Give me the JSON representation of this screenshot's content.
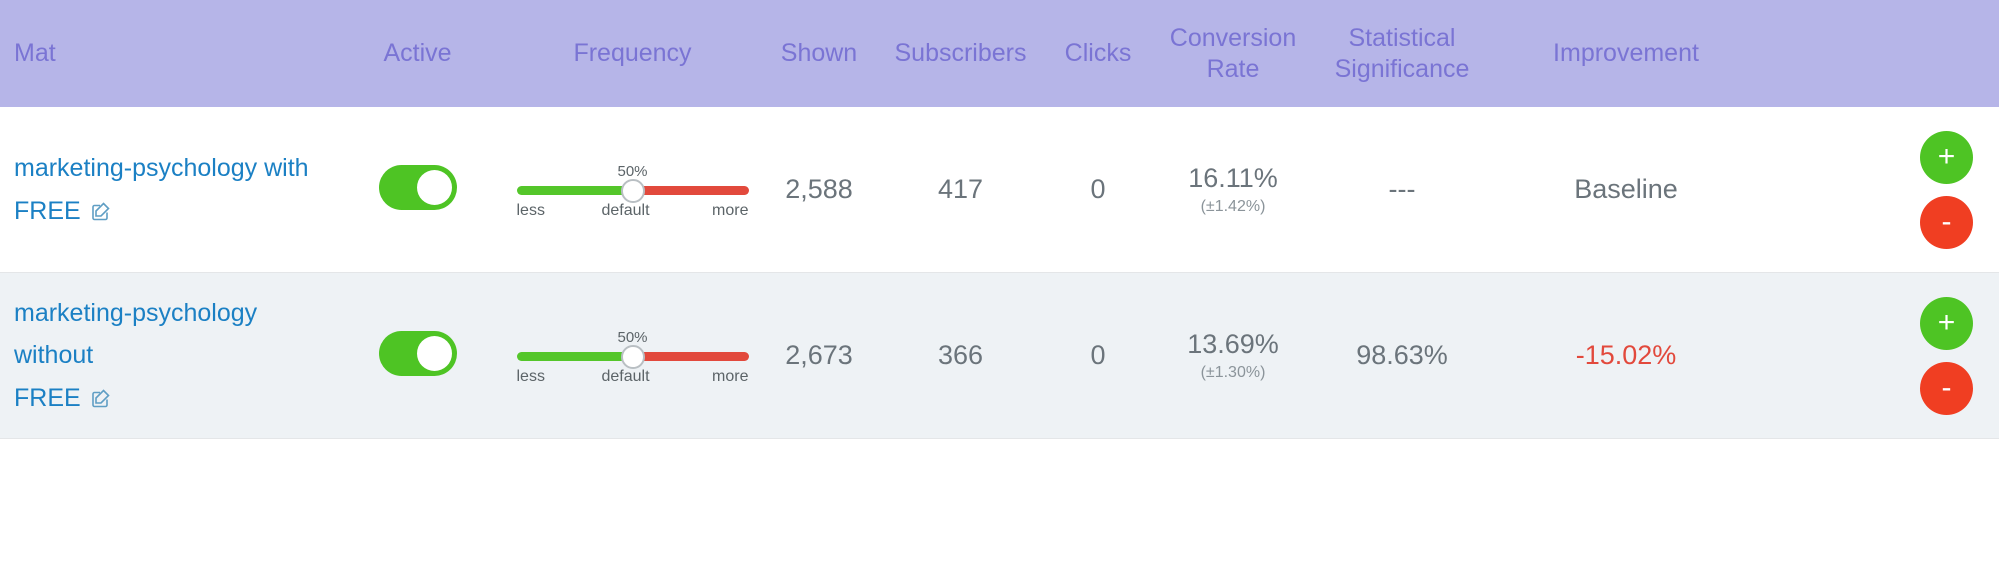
{
  "table": {
    "columns": {
      "mat": "Mat",
      "active": "Active",
      "frequency": "Frequency",
      "shown": "Shown",
      "subscribers": "Subscribers",
      "clicks": "Clicks",
      "conversion_rate_line1": "Conversion",
      "conversion_rate_line2": "Rate",
      "statistical_significance_line1": "Statistical",
      "statistical_significance_line2": "Significance",
      "improvement": "Improvement"
    },
    "header_bg": "#b6b5e8",
    "header_text_color": "#7a74d4",
    "link_color": "#1b80c4",
    "negative_color": "#e2493c",
    "toggle_on_color": "#4ec424",
    "slider_left_color": "#54c62a",
    "slider_right_color": "#e2493c",
    "rows": [
      {
        "name_line1": "marketing-psychology with",
        "name_line2": "FREE",
        "edit_icon": "edit-square-icon",
        "active": true,
        "frequency_value": "50%",
        "frequency_label_less": "less",
        "frequency_label_default": "default",
        "frequency_label_more": "more",
        "frequency_percent": 50,
        "shown": "2,588",
        "subscribers": "417",
        "clicks": "0",
        "conversion_rate": "16.11%",
        "conversion_rate_margin": "(±1.42%)",
        "statistical_significance": "---",
        "improvement": "Baseline",
        "improvement_negative": false,
        "add_label": "+",
        "remove_label": "-"
      },
      {
        "name_line1": "marketing-psychology without",
        "name_line2": "FREE",
        "edit_icon": "edit-square-icon",
        "active": true,
        "frequency_value": "50%",
        "frequency_label_less": "less",
        "frequency_label_default": "default",
        "frequency_label_more": "more",
        "frequency_percent": 50,
        "shown": "2,673",
        "subscribers": "366",
        "clicks": "0",
        "conversion_rate": "13.69%",
        "conversion_rate_margin": "(±1.30%)",
        "statistical_significance": "98.63%",
        "improvement": "-15.02%",
        "improvement_negative": true,
        "add_label": "+",
        "remove_label": "-"
      }
    ]
  }
}
